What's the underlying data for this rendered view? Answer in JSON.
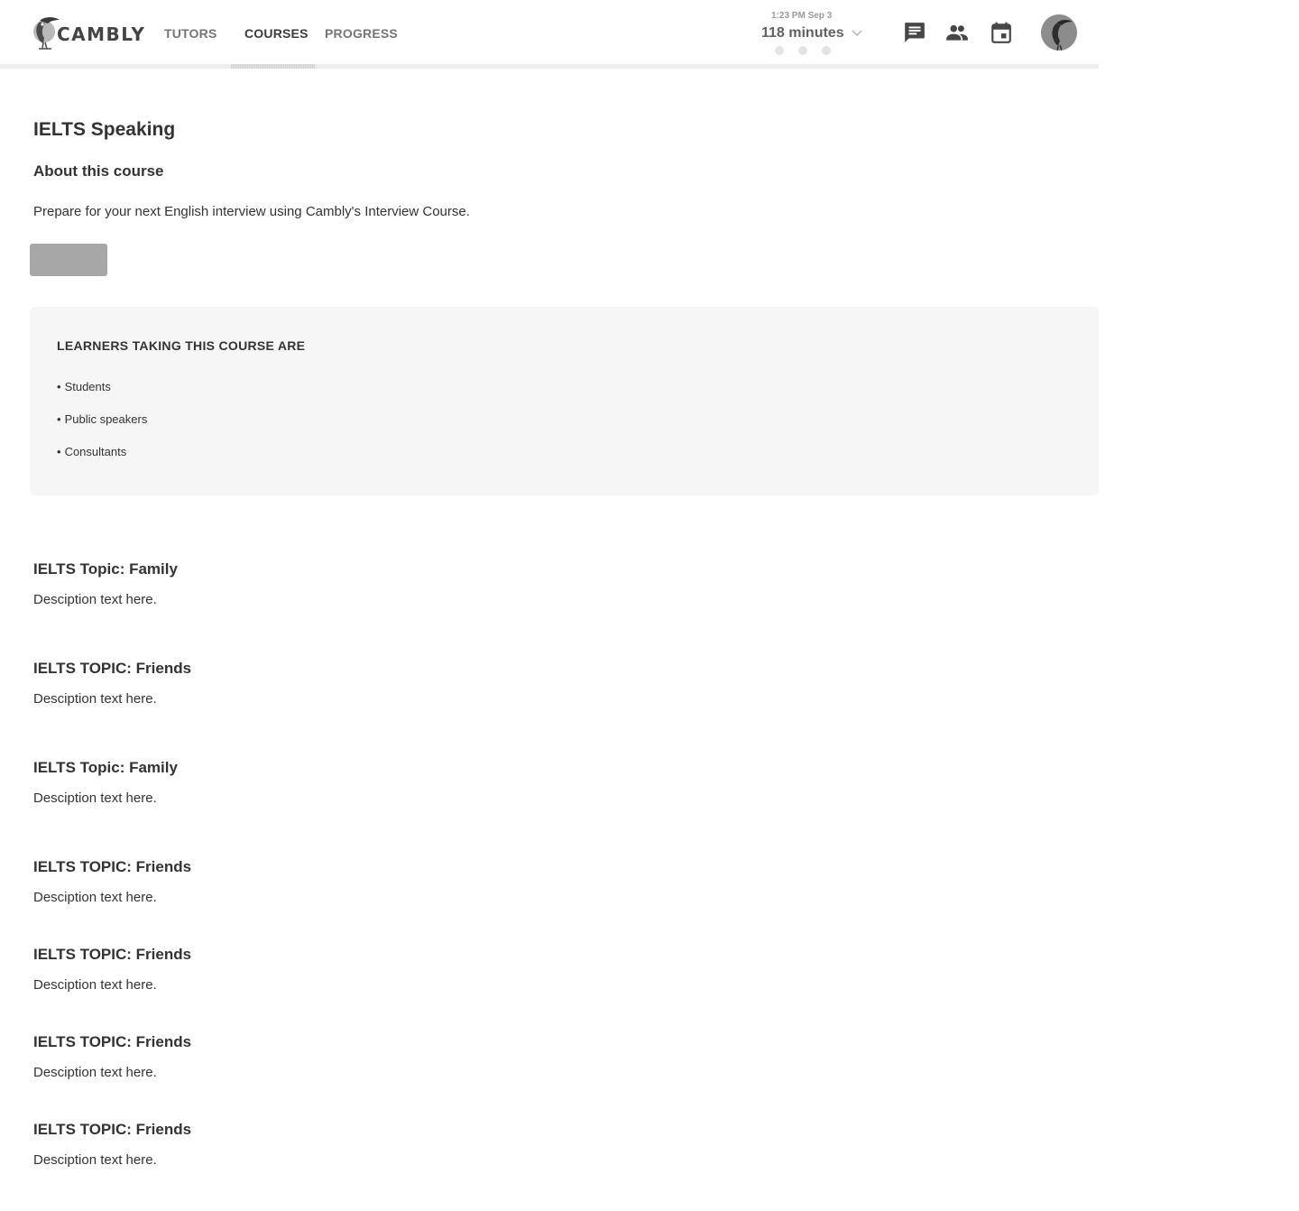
{
  "header": {
    "logo_text": "CAMBLY",
    "nav": [
      {
        "label": "TUTORS",
        "active": false
      },
      {
        "label": "COURSES",
        "active": true
      },
      {
        "label": "PROGRESS",
        "active": false
      }
    ],
    "clock": "1:23 PM Sep 3",
    "minutes": "118 minutes",
    "icons": [
      "chat-icon",
      "people-icon",
      "calendar-icon"
    ]
  },
  "course": {
    "title": "IELTS Speaking",
    "about_heading": "About this course",
    "description": "Prepare for your next English interview using Cambly's Interview Course."
  },
  "learners": {
    "heading": "LEARNERS TAKING THIS COURSE ARE",
    "items": [
      "Students",
      "Public speakers",
      "Consultants"
    ]
  },
  "topics": [
    {
      "title": "IELTS Topic: Family",
      "description": "Desciption text here."
    },
    {
      "title": "IELTS TOPIC: Friends",
      "description": "Desciption text here."
    },
    {
      "title": "IELTS Topic: Family",
      "description": "Desciption text here."
    },
    {
      "title": "IELTS TOPIC: Friends",
      "description": "Desciption text here."
    },
    {
      "title": "IELTS TOPIC: Friends",
      "description": "Desciption text here."
    },
    {
      "title": "IELTS TOPIC: Friends",
      "description": "Desciption text here."
    },
    {
      "title": "IELTS TOPIC: Friends",
      "description": "Desciption text here."
    }
  ],
  "colors": {
    "text": "#333333",
    "nav_inactive": "#757575",
    "button": "#a7a7a7",
    "panel": "#f6f6f6"
  }
}
